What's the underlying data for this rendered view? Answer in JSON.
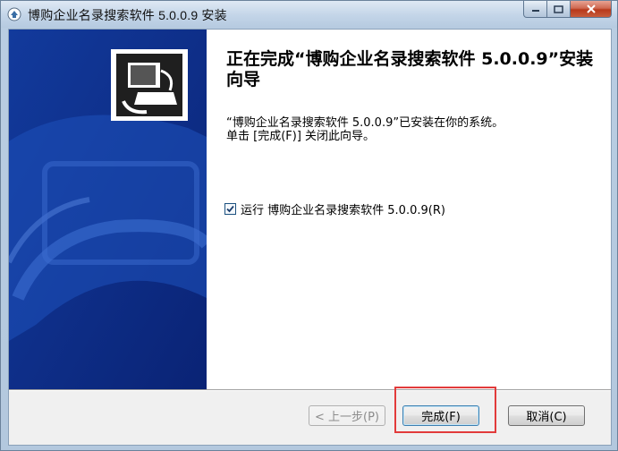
{
  "window": {
    "title": "博购企业名录搜索软件 5.0.0.9 安装"
  },
  "wizard": {
    "heading": "正在完成“博购企业名录搜索软件 5.0.0.9”安装向导",
    "body_line1": "“博购企业名录搜索软件 5.0.0.9”已安装在你的系统。",
    "body_line2": "单击 [完成(F)] 关闭此向导。",
    "run_checkbox_label": "运行 博购企业名录搜索软件 5.0.0.9(R)",
    "run_checkbox_checked": true
  },
  "buttons": {
    "back": "< 上一步(P)",
    "finish": "完成(F)",
    "cancel": "取消(C)"
  },
  "colors": {
    "left_panel": "#0e2f8f",
    "highlight": "#e23b3b"
  },
  "icons": {
    "title": "installer-icon",
    "logo": "computer-setup-icon"
  }
}
